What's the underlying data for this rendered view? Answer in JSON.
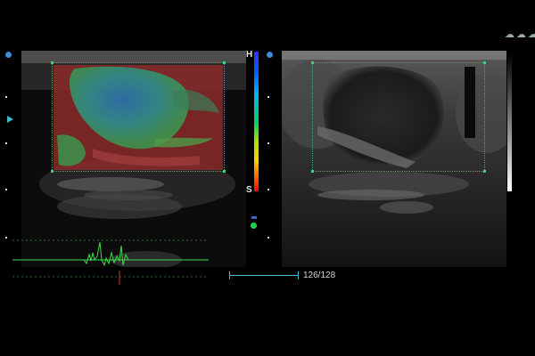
{
  "elastography": {
    "scale_high_label": "H",
    "scale_low_label": "S"
  },
  "playback": {
    "frame_counter": "126/128"
  },
  "toolbar": {
    "icons": [
      "cloud-upload-icon",
      "cloud-link-icon",
      "cloud-icon"
    ]
  },
  "colors": {
    "roi_border": "#2fb36a",
    "waveform": "#3adf4a",
    "playback_line": "#4ab6c8",
    "probe_marker": "#3d8bd6"
  }
}
